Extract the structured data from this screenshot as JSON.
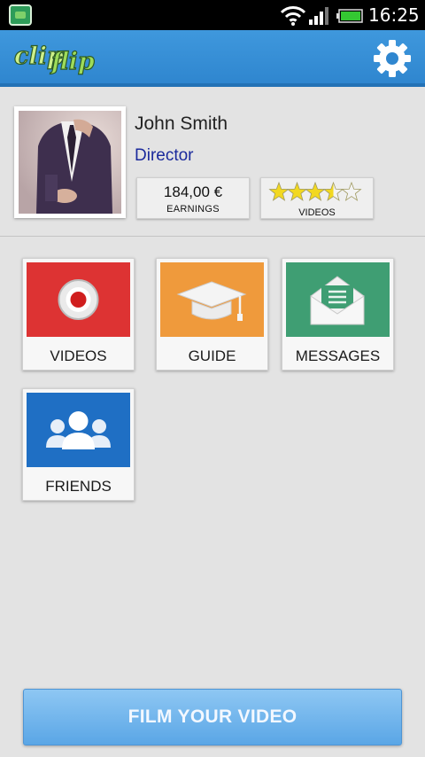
{
  "status_bar": {
    "time": "16:25"
  },
  "action_bar": {
    "logo_text_1": "clip",
    "logo_text_2": "flip",
    "settings_icon": "gear-icon"
  },
  "profile": {
    "name": "John Smith",
    "role": "Director",
    "earnings_value": "184,00 €",
    "earnings_label": "EARNINGS",
    "rating_label": "VIDEOS",
    "rating_stars": 3.5,
    "rating_max": 5
  },
  "tiles": [
    {
      "label": "VIDEOS",
      "icon": "record-icon",
      "color": "#dd3333"
    },
    {
      "label": "GUIDE",
      "icon": "graduation-cap-icon",
      "color": "#ef9a3c"
    },
    {
      "label": "MESSAGES",
      "icon": "envelope-icon",
      "color": "#3f9e73"
    },
    {
      "label": "FRIENDS",
      "icon": "group-icon",
      "color": "#1f6fc4"
    }
  ],
  "film_button": {
    "label": "FILM YOUR VIDEO"
  },
  "colors": {
    "action_bar": "#2f86cf",
    "accent_text": "#1b2a9c",
    "star": "#f2d820"
  }
}
